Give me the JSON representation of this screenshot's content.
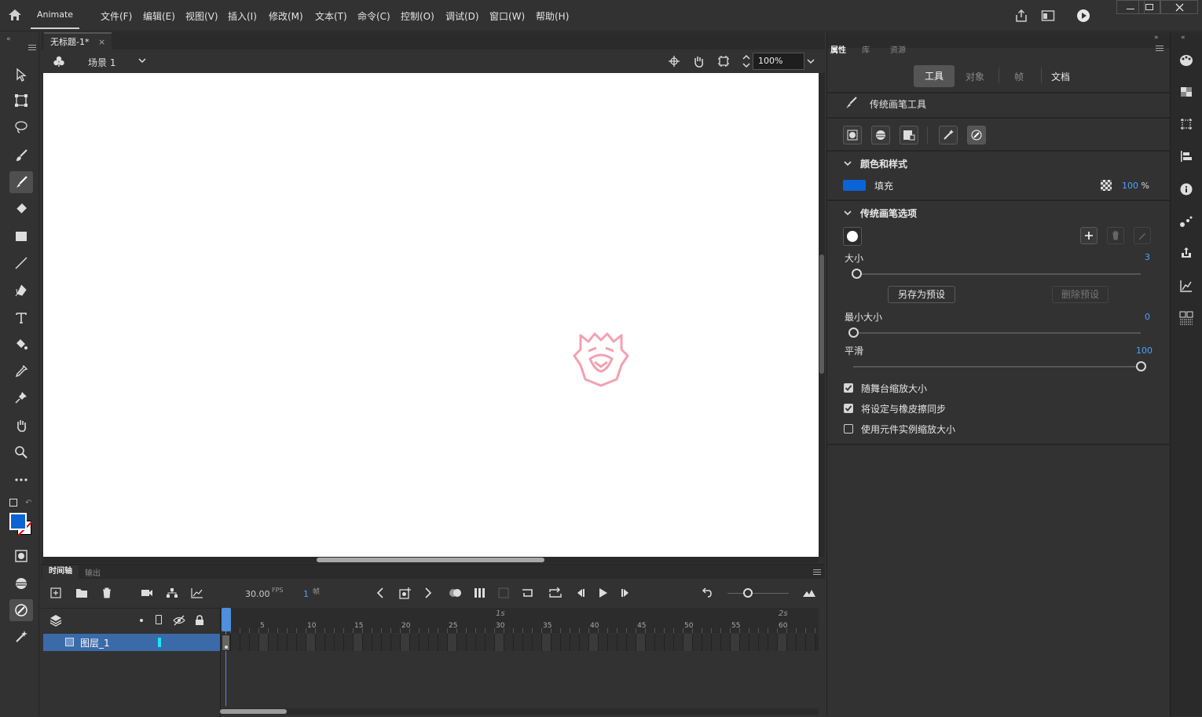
{
  "app": {
    "name": "Animate"
  },
  "menu": [
    "文件(F)",
    "编辑(E)",
    "视图(V)",
    "插入(I)",
    "修改(M)",
    "文本(T)",
    "命令(C)",
    "控制(O)",
    "调试(D)",
    "窗口(W)",
    "帮助(H)"
  ],
  "document": {
    "tab_title": "无标题-1*",
    "close": "×"
  },
  "scene": {
    "name": "场景 1",
    "zoom": "100%"
  },
  "panel_tabs": {
    "properties": "属性",
    "library": "库",
    "assets": "资源"
  },
  "prop_tabs": {
    "tool": "工具",
    "object": "对象",
    "frame": "帧",
    "document": "文档"
  },
  "tool_name": "传统画笔工具",
  "color_section": {
    "title": "颜色和样式",
    "fill_label": "填充",
    "fill_color": "#0a64d6",
    "alpha": "100",
    "alpha_unit": "%"
  },
  "brush_section": {
    "title": "传统画笔选项",
    "size_label": "大小",
    "size_value": "3",
    "size_pos": 0.01,
    "save_preset": "另存为预设",
    "delete_preset": "删除预设",
    "min_size_label": "最小大小",
    "min_size_value": "0",
    "min_size_pos": 0.0,
    "smooth_label": "平滑",
    "smooth_value": "100",
    "smooth_pos": 1.0
  },
  "checkboxes": [
    {
      "label": "随舞台缩放大小",
      "checked": true
    },
    {
      "label": "将设定与橡皮擦同步",
      "checked": true
    },
    {
      "label": "使用元件实例缩放大小",
      "checked": false
    }
  ],
  "timeline": {
    "tab": "时间轴",
    "output_tab": "输出",
    "fps": "30.00",
    "fps_label": "FPS",
    "frame": "1",
    "frame_label": "帧",
    "layer_name": "图层_1",
    "ruler_marks": [
      "5",
      "10",
      "15",
      "20",
      "25",
      "30",
      "35",
      "40",
      "45",
      "50",
      "55",
      "60"
    ],
    "second_marks": [
      "1s",
      "2s"
    ]
  },
  "colors": {
    "accent": "#0a64d6",
    "layer_highlight": "#3b6aa8",
    "playhead": "#4f8fdc",
    "logo": "#f4a0b0"
  }
}
